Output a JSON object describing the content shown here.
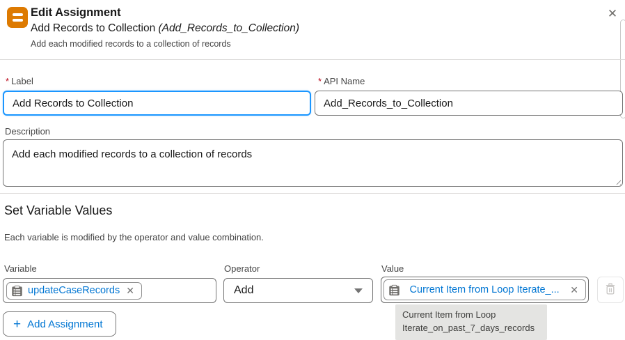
{
  "header": {
    "title": "Edit Assignment",
    "subtitle_name": "Add Records to Collection ",
    "subtitle_api": "(Add_Records_to_Collection)",
    "description": "Add each modified records to a collection of records"
  },
  "icons": {
    "close": "✕",
    "pill_remove": "✕",
    "plus": "+"
  },
  "form": {
    "label_field": {
      "required": "*",
      "label": "Label",
      "value": "Add Records to Collection"
    },
    "api_name_field": {
      "required": "*",
      "label": "API Name",
      "value": "Add_Records_to_Collection"
    },
    "description_field": {
      "label": "Description",
      "value": "Add each modified records to a collection of records"
    }
  },
  "section": {
    "title": "Set Variable Values",
    "subtitle": "Each variable is modified by the operator and value combination."
  },
  "assignment_row": {
    "variable": {
      "label": "Variable",
      "pill_text": "updateCaseRecords"
    },
    "operator": {
      "label": "Operator",
      "value": "Add"
    },
    "value": {
      "label": "Value",
      "pill_text": "Current Item from Loop Iterate_..."
    }
  },
  "tooltip": {
    "line1": "Current Item from Loop",
    "line2": "Iterate_on_past_7_days_records"
  },
  "buttons": {
    "add_assignment": "Add Assignment"
  },
  "colors": {
    "accent_blue": "#0176d3",
    "focus_border": "#1b96ff",
    "assignment_orange": "#dd7a01",
    "required_red": "#ba0517",
    "tooltip_bg": "#e4e4e2"
  }
}
